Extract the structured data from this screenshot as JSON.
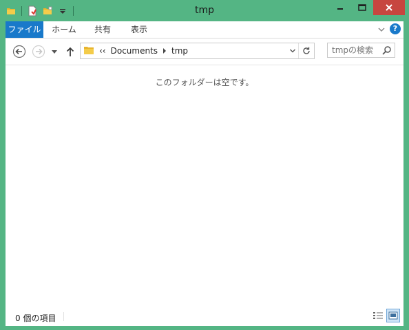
{
  "window": {
    "title": "tmp"
  },
  "ribbon": {
    "tabs": [
      {
        "label": "ファイル"
      },
      {
        "label": "ホーム"
      },
      {
        "label": "共有"
      },
      {
        "label": "表示"
      }
    ]
  },
  "nav": {
    "breadcrumb": {
      "overflow": "‹‹",
      "items": [
        "Documents",
        "tmp"
      ]
    },
    "search": {
      "placeholder": "tmpの検索"
    }
  },
  "content": {
    "empty_message": "このフォルダーは空です。"
  },
  "status": {
    "item_count": "0 個の項目"
  },
  "colors": {
    "window_border": "#54b584",
    "file_tab": "#1979ca",
    "close_button": "#c7463f",
    "help_icon": "#1979ca"
  },
  "icons": [
    "folder-icon",
    "properties-icon",
    "new-folder-icon",
    "customize-qat-icon",
    "minimize-icon",
    "maximize-icon",
    "close-icon",
    "ribbon-collapse-icon",
    "help-icon",
    "back-icon",
    "forward-icon",
    "recent-locations-icon",
    "up-icon",
    "refresh-icon",
    "search-icon",
    "details-view-icon",
    "large-icons-view-icon"
  ]
}
